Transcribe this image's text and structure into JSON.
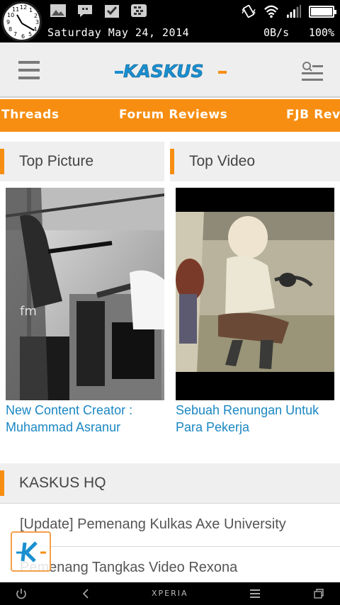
{
  "status_bar": {
    "date": "Saturday May 24, 2014",
    "network_speed": "0B/s",
    "battery_percent": "100%",
    "battery_level": 1.0,
    "clock_numbers": [
      "12",
      "1",
      "2",
      "3",
      "4",
      "5",
      "6",
      "7",
      "8",
      "9",
      "10",
      "11"
    ],
    "notification_icons": [
      "gallery-icon",
      "bbm-chat-icon",
      "task-check-icon",
      "bbm-icon"
    ]
  },
  "app_bar": {
    "logo_text": "KASKUS",
    "menu_icon": "hamburger-menu-icon",
    "search_icon": "search-menu-icon"
  },
  "tabs": [
    {
      "label": "Threads"
    },
    {
      "label": "Forum Reviews"
    },
    {
      "label": "FJB Rev"
    }
  ],
  "sections": {
    "top_picture": "Top Picture",
    "top_video": "Top Video",
    "kaskus_hq": "KASKUS HQ"
  },
  "cards": [
    {
      "caption": "New Content Creator : Muhammad Asranur"
    },
    {
      "caption": "Sebuah Renungan Untuk Para Pekerja"
    }
  ],
  "hq_items": [
    {
      "label": "[Update] Pemenang Kulkas Axe University"
    },
    {
      "label": "Pemenang Tangkas Video Rexona"
    }
  ],
  "nav_bar": {
    "brand": "XPERIA"
  },
  "colors": {
    "accent": "#f78e12",
    "link": "#1a87c3",
    "logo_blue": "#1a8fd0"
  }
}
